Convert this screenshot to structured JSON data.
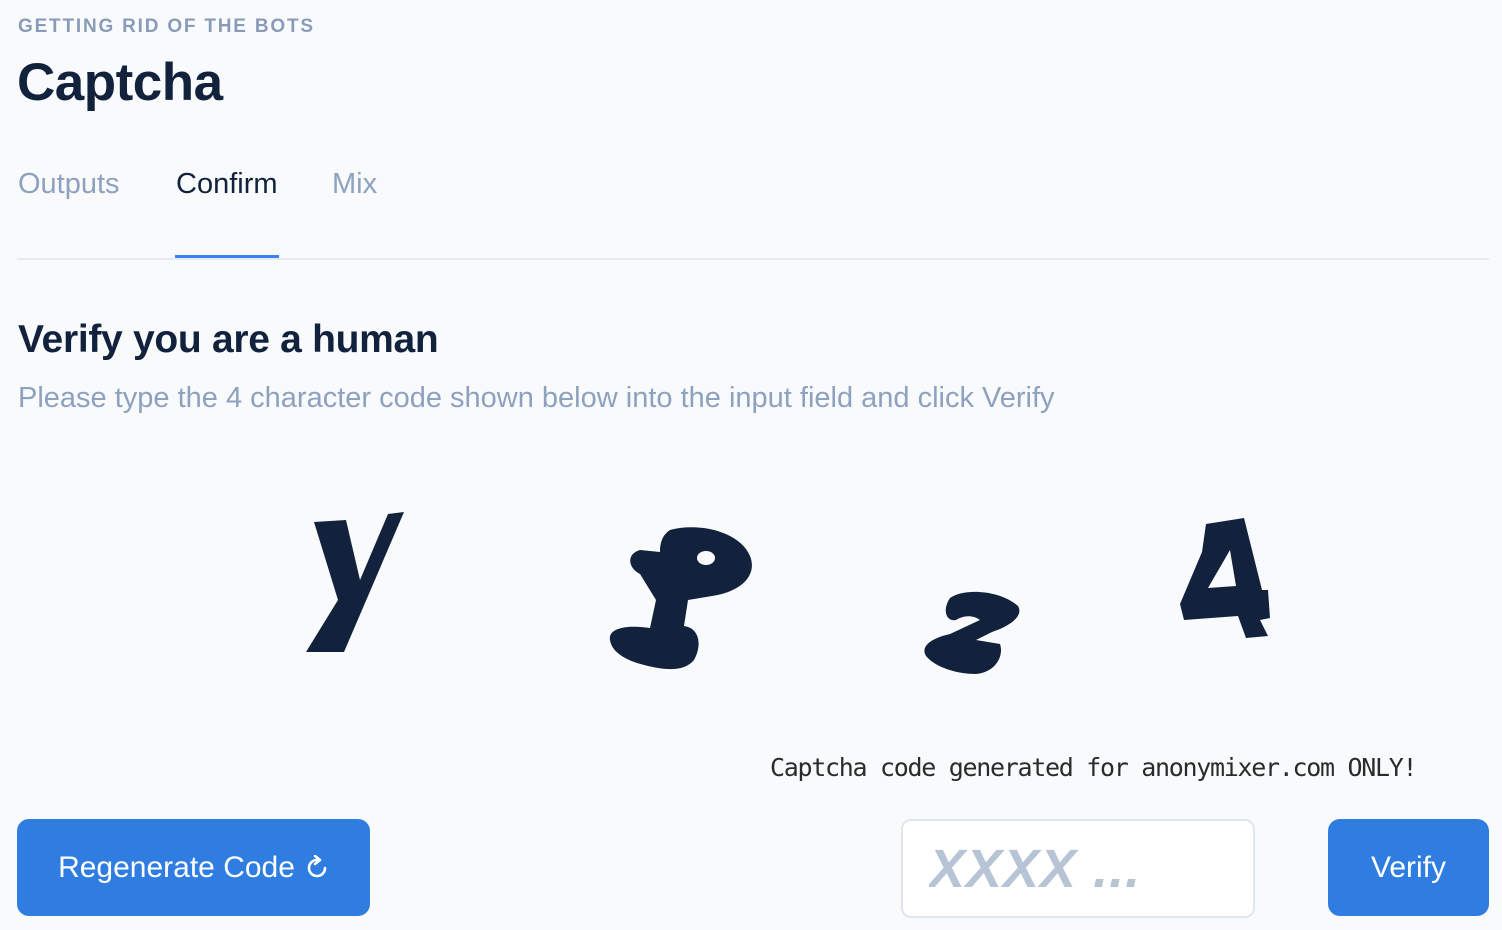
{
  "header": {
    "eyebrow": "GETTING RID OF THE BOTS",
    "title": "Captcha"
  },
  "tabs": [
    {
      "label": "Outputs",
      "active": false
    },
    {
      "label": "Confirm",
      "active": true
    },
    {
      "label": "Mix",
      "active": false
    }
  ],
  "verify": {
    "heading": "Verify you are a human",
    "subtitle": "Please type the 4 character code shown below into the input field and click Verify"
  },
  "captcha": {
    "characters": [
      "y",
      "P",
      "z",
      "4"
    ],
    "note": "Captcha code generated for anonymixer.com ONLY!",
    "glyph_color": "#12223d"
  },
  "actions": {
    "regenerate_label": "Regenerate Code",
    "regenerate_icon": "refresh-icon",
    "input_placeholder": "XXXX ...",
    "input_value": "",
    "verify_label": "Verify"
  },
  "colors": {
    "accent": "#2f7de1",
    "tab_underline": "#3b82f6",
    "text_dark": "#12223d",
    "text_muted": "#8ea1bf"
  }
}
